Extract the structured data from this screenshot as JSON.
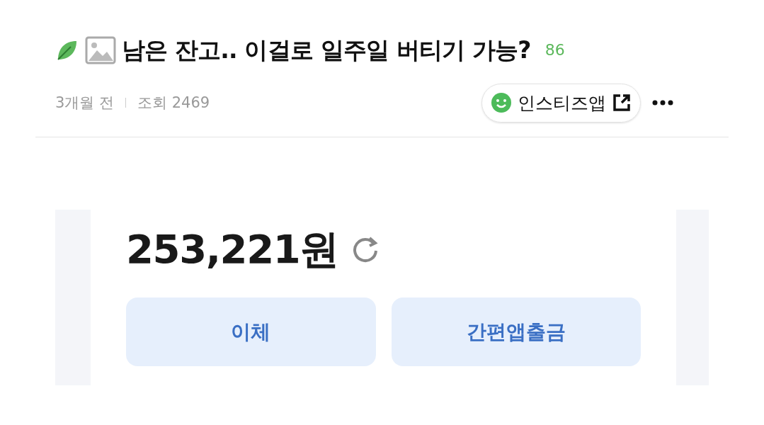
{
  "post": {
    "title": "남은 잔고.. 이걸로 일주일 버티기 가능?",
    "comment_count": "86",
    "time": "3개월 전",
    "views": "조회 2469",
    "app_button": "인스티즈앱"
  },
  "embedded_screen": {
    "balance": "253,221원",
    "buttons": [
      "이체",
      "간편앱출금"
    ]
  }
}
